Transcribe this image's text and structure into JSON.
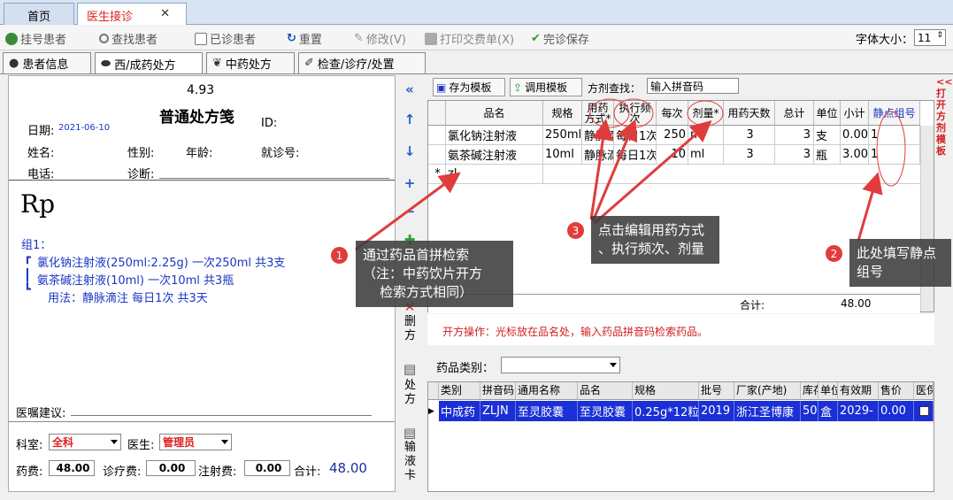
{
  "top_tabs": {
    "home": "首页",
    "active": "医生接诊",
    "close": "✕"
  },
  "toolbar": {
    "register": "挂号患者",
    "find": "查找患者",
    "visited": "已诊患者",
    "reset": "重置",
    "modify": "修改(V)",
    "print": "打印交费单(X)",
    "finish": "完诊保存",
    "font_size_label": "字体大小：",
    "font_size_value": "11"
  },
  "sub_tabs": [
    "患者信息",
    "西/成药处方",
    "中药处方",
    "检查/诊疗/处置"
  ],
  "rx": {
    "version": "4.93",
    "title": "普通处方笺",
    "date_label": "日期:",
    "date_value": "2021-06-10",
    "id_label": "ID:",
    "name_label": "姓名:",
    "gender_label": "性别:",
    "age_label": "年龄:",
    "visit_label": "就诊号:",
    "phone_label": "电话:",
    "diag_label": "诊断:",
    "rp": "Rp",
    "group_label": "组1：",
    "line1": "氯化钠注射液(250ml:2.25g)  一次250ml  共3支",
    "line2": "氨茶碱注射液(10ml)  一次10ml  共3瓶",
    "usage": "用法：静脉滴注    每日1次  共3天",
    "advice_label": "医嘱建议:",
    "dept_label": "科室:",
    "dept_value": "全科",
    "doctor_label": "医生:",
    "doctor_value": "管理员",
    "drug_fee_label": "药费:",
    "drug_fee": "48.00",
    "treat_fee_label": "诊疗费:",
    "treat_fee": "0.00",
    "inject_fee_label": "注射费:",
    "inject_fee": "0.00",
    "total_label": "合计:",
    "total": "48.00"
  },
  "vbar": {
    "delete": "删方",
    "rx_print": "处方",
    "infusion": "输液卡"
  },
  "grid_toolbar": {
    "save_tpl": "存为模板",
    "use_tpl": "调用模板",
    "search_label": "方剂查找：",
    "search_placeholder": "输入拼音码",
    "side_link": "<<打开方剂模板"
  },
  "grid": {
    "headers": [
      "品名",
      "规格",
      "用药方式*",
      "执行频次",
      "每次",
      "剂量*",
      "用药天数",
      "总计",
      "单位",
      "小计",
      "静点组号"
    ],
    "rows": [
      [
        "氯化钠注射液",
        "250ml",
        "静脉滴注",
        "每日1次",
        "250",
        "ml",
        "3",
        "3",
        "支",
        "0.00",
        "1"
      ],
      [
        "氨茶碱注射液",
        "10ml",
        "静脉滴注",
        "每日1次",
        "10",
        "ml",
        "3",
        "3",
        "瓶",
        "3.00",
        "1"
      ]
    ],
    "new_row_marker": "*",
    "new_row_value": "zl",
    "sum_label": "合计:",
    "sum_value": "48.00"
  },
  "hint": "开方操作：光标放在品名处，输入药品拼音码检索药品。",
  "category_label": "药品类别：",
  "bottom_grid": {
    "headers": [
      "类别",
      "拼音码",
      "通用名称",
      "品名",
      "规格",
      "批号",
      "厂家(产地)",
      "库存",
      "单位",
      "有效期",
      "售价",
      "医保"
    ],
    "row": [
      "中成药",
      "ZLJN",
      "至灵胶囊",
      "至灵胶囊",
      "0.25g*12粒",
      "2019",
      "浙江圣博康",
      "50",
      "盒",
      "2029-",
      "0.00",
      ""
    ]
  },
  "callouts": {
    "c1": "通过药品首拼检索\n（注：中药饮片开方\n    检索方式相同）",
    "c2": "此处填写静点\n组号",
    "c3": "点击编辑用药方式\n、执行频次、剂量"
  },
  "badges": [
    "1",
    "2",
    "3"
  ]
}
